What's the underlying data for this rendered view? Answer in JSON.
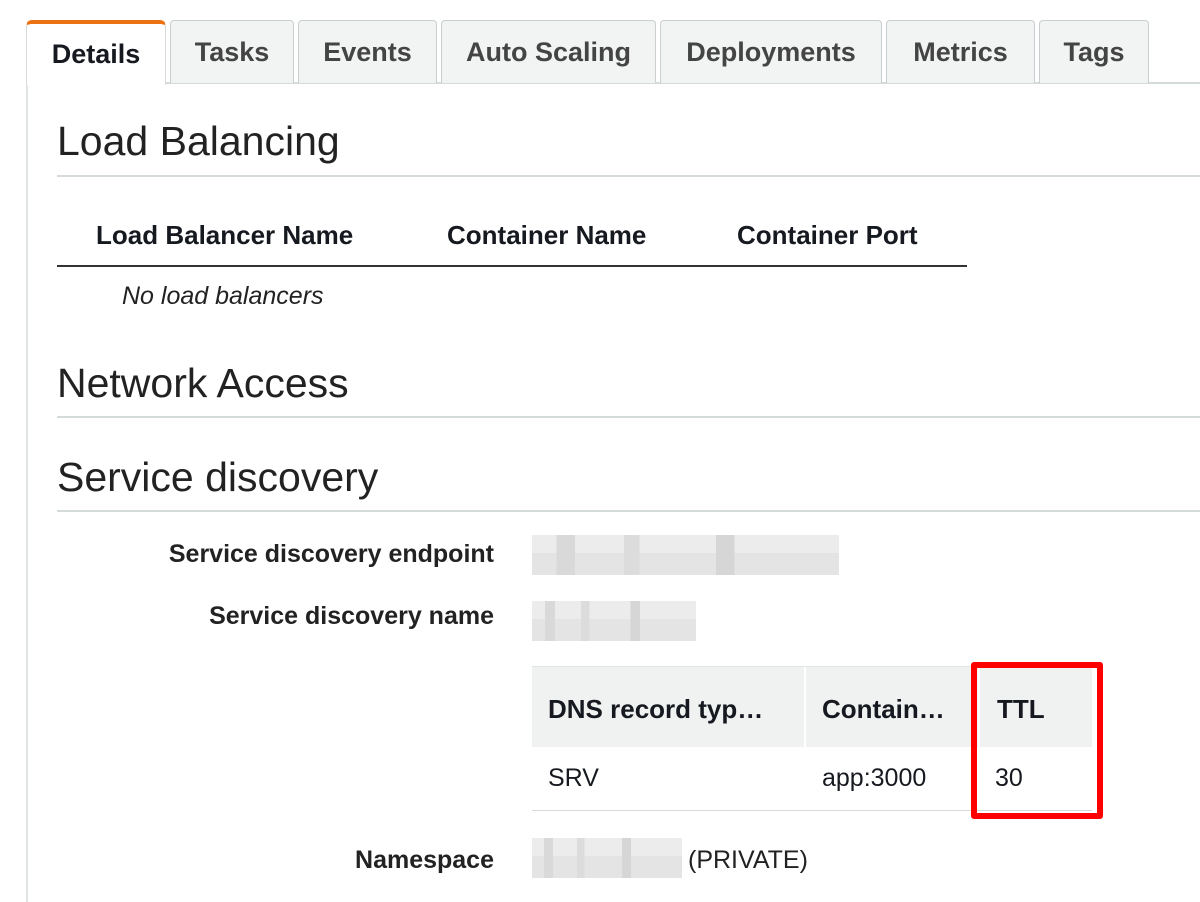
{
  "tabs": [
    {
      "label": "Details",
      "active": true
    },
    {
      "label": "Tasks",
      "active": false
    },
    {
      "label": "Events",
      "active": false
    },
    {
      "label": "Auto Scaling",
      "active": false
    },
    {
      "label": "Deployments",
      "active": false
    },
    {
      "label": "Metrics",
      "active": false
    },
    {
      "label": "Tags",
      "active": false
    }
  ],
  "load_balancing": {
    "title": "Load Balancing",
    "columns": [
      "Load Balancer Name",
      "Container Name",
      "Container Port"
    ],
    "empty_text": "No load balancers"
  },
  "network_access": {
    "title": "Network Access"
  },
  "service_discovery": {
    "title": "Service discovery",
    "endpoint_label": "Service discovery endpoint",
    "name_label": "Service discovery name",
    "dns_table": {
      "columns": [
        "DNS record typ…",
        "Contain…",
        "TTL"
      ],
      "rows": [
        [
          "SRV",
          "app:3000",
          "30"
        ]
      ]
    },
    "namespace_label": "Namespace",
    "namespace_suffix": "(PRIVATE)"
  },
  "colors": {
    "active_tab_accent": "#ec7211",
    "highlight": "#ff0000"
  }
}
